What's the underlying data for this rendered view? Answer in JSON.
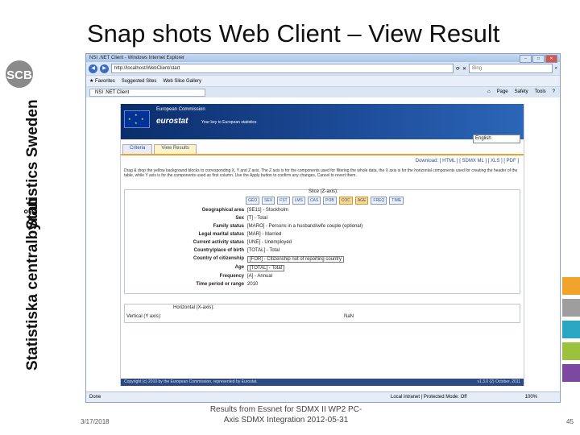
{
  "slide": {
    "title": "Snap shots Web Client – View Result",
    "footer_date": "3/17/2018",
    "footer_center": "Results from Essnet for SDMX II WP2 PC-Axis SDMX Integration 2012-05-31",
    "page_number": "45",
    "logo_text": "SCB",
    "vertical_text_1": "Statistics Sweden",
    "vertical_text_2": "Statistiska centralbyrån",
    "accent_colors": [
      "#f2a32a",
      "#9e9e9e",
      "#2aa6c2",
      "#9ac23c",
      "#7b4aa0"
    ]
  },
  "browser": {
    "window_title": "NSI .NET Client - Windows Internet Explorer",
    "url": "http://localhost/WebClient/start",
    "search_placeholder": "Bing",
    "favorites_label": "Favorites",
    "suggested_sites": "Suggested Sites",
    "web_slice": "Web Slice Gallery",
    "tab_label": "NSI .NET Client",
    "toolbar": [
      "Page",
      "Safety",
      "Tools"
    ],
    "status_done": "Done",
    "status_zone": "Local intranet | Protected Mode: Off",
    "zoom": "100%"
  },
  "app": {
    "ec_name": "European Commission",
    "eurostat": "eurostat",
    "tagline": "Your key to European statistics",
    "language": "English",
    "tabs": [
      "Criteria",
      "View Results"
    ],
    "download": "Download: [ HTML ] [ SDMX ML ] [ XLS ] [ PDF ]",
    "instructions": "Drag & drop the yellow background blocks to corresponding X, Y and Z axis. The Z axis is for the components used for filtering the whole data, the X axis is for the horizontal components used for creating the header of the table, while Y axis is for the components used as first column. Use the Apply button to confirm any changes, Cancel to revert them.",
    "slice_label": "Slice (Z-axis):",
    "dim_buttons": [
      "GEO",
      "SEX",
      "FST",
      "LMS",
      "CAS",
      "POB",
      "COC",
      "AGE",
      "FREQ",
      "TIME"
    ],
    "dimensions": [
      {
        "label": "Geographical area",
        "value": "[SE11] - Stockholm"
      },
      {
        "label": "Sex",
        "value": "[T] - Total"
      },
      {
        "label": "Family status",
        "value": "[MARO] - Persons in a husband/wife couple (optional)"
      },
      {
        "label": "Legal marital status",
        "value": "[MAR] - Married"
      },
      {
        "label": "Current activity status",
        "value": "[UNE] - Unemployed"
      },
      {
        "label": "Country/place of birth",
        "value": "[TOTAL] - Total"
      },
      {
        "label": "Country of citizenship",
        "value": "[FOR] - Citizenship not of reporting country"
      },
      {
        "label": "Age",
        "value": "[TOTAL] - Total"
      },
      {
        "label": "Frequency",
        "value": "[A] - Annual"
      },
      {
        "label": "Time period or range",
        "value": "2010"
      }
    ],
    "horizontal_label": "Horizontal (X-axis):",
    "vertical_label": "Vertical (Y axis):",
    "cell_value": "NaN",
    "copyright": "Copyright (c) 2010 by the European Commission, represented by Eurostat.",
    "version": "v1.3.0 (2) October, 2011"
  }
}
